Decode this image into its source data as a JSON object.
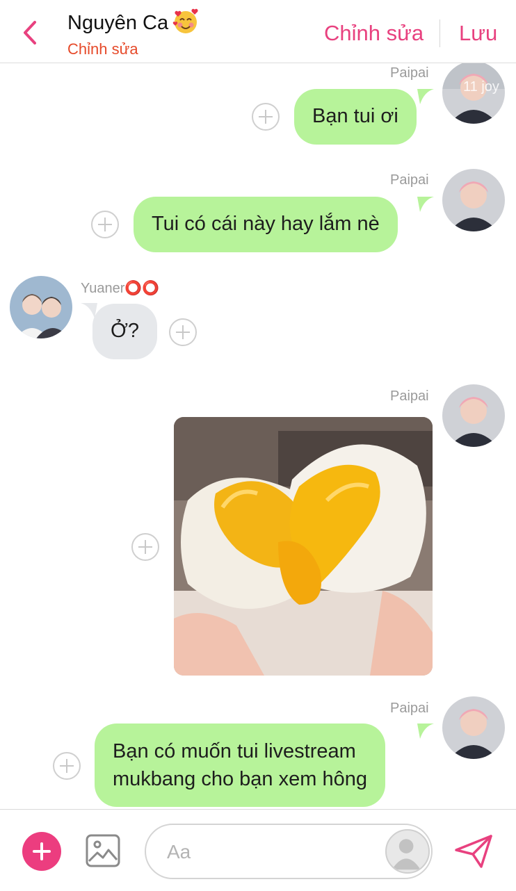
{
  "header": {
    "title": "Nguyên Ca",
    "subtitle": "Chỉnh sửa",
    "edit_label": "Chỉnh sửa",
    "save_label": "Lưu",
    "accent_color": "#e8417f"
  },
  "messages": [
    {
      "sender": "Paipai",
      "side": "right",
      "type": "text",
      "text": "Bạn tui ơi",
      "avatar_overlay": "11 joy"
    },
    {
      "sender": "Paipai",
      "side": "right",
      "type": "text",
      "text": "Tui có cái này hay lắm nè"
    },
    {
      "sender": "Yuaner⭕⭕",
      "side": "left",
      "type": "text",
      "text": "Ở?"
    },
    {
      "sender": "Paipai",
      "side": "right",
      "type": "image",
      "image_subject": "custard-bun-photo"
    },
    {
      "sender": "Paipai",
      "side": "right",
      "type": "text",
      "lines": [
        "Bạn có muốn tui livestream",
        "mukbang cho bạn xem hông"
      ]
    }
  ],
  "composer": {
    "placeholder": "Aa"
  },
  "colors": {
    "bubble_outgoing": "#b7f39a",
    "bubble_incoming": "#e6e8eb",
    "add_button": "#ec3d7f"
  }
}
